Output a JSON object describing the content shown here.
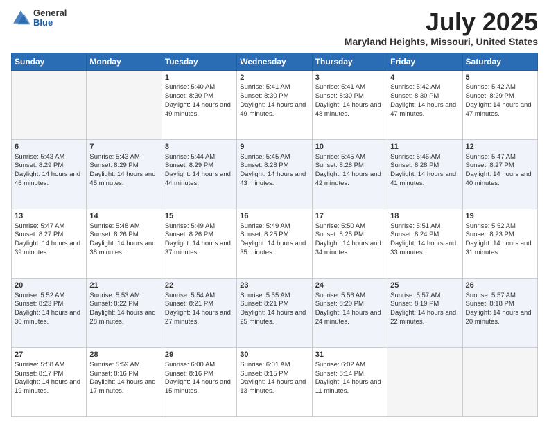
{
  "header": {
    "logo_general": "General",
    "logo_blue": "Blue",
    "month_title": "July 2025",
    "location": "Maryland Heights, Missouri, United States"
  },
  "days_of_week": [
    "Sunday",
    "Monday",
    "Tuesday",
    "Wednesday",
    "Thursday",
    "Friday",
    "Saturday"
  ],
  "weeks": [
    [
      {
        "day": "",
        "sunrise": "",
        "sunset": "",
        "daylight": "",
        "empty": true
      },
      {
        "day": "",
        "sunrise": "",
        "sunset": "",
        "daylight": "",
        "empty": true
      },
      {
        "day": "1",
        "sunrise": "Sunrise: 5:40 AM",
        "sunset": "Sunset: 8:30 PM",
        "daylight": "Daylight: 14 hours and 49 minutes.",
        "empty": false
      },
      {
        "day": "2",
        "sunrise": "Sunrise: 5:41 AM",
        "sunset": "Sunset: 8:30 PM",
        "daylight": "Daylight: 14 hours and 49 minutes.",
        "empty": false
      },
      {
        "day": "3",
        "sunrise": "Sunrise: 5:41 AM",
        "sunset": "Sunset: 8:30 PM",
        "daylight": "Daylight: 14 hours and 48 minutes.",
        "empty": false
      },
      {
        "day": "4",
        "sunrise": "Sunrise: 5:42 AM",
        "sunset": "Sunset: 8:30 PM",
        "daylight": "Daylight: 14 hours and 47 minutes.",
        "empty": false
      },
      {
        "day": "5",
        "sunrise": "Sunrise: 5:42 AM",
        "sunset": "Sunset: 8:29 PM",
        "daylight": "Daylight: 14 hours and 47 minutes.",
        "empty": false
      }
    ],
    [
      {
        "day": "6",
        "sunrise": "Sunrise: 5:43 AM",
        "sunset": "Sunset: 8:29 PM",
        "daylight": "Daylight: 14 hours and 46 minutes.",
        "empty": false
      },
      {
        "day": "7",
        "sunrise": "Sunrise: 5:43 AM",
        "sunset": "Sunset: 8:29 PM",
        "daylight": "Daylight: 14 hours and 45 minutes.",
        "empty": false
      },
      {
        "day": "8",
        "sunrise": "Sunrise: 5:44 AM",
        "sunset": "Sunset: 8:29 PM",
        "daylight": "Daylight: 14 hours and 44 minutes.",
        "empty": false
      },
      {
        "day": "9",
        "sunrise": "Sunrise: 5:45 AM",
        "sunset": "Sunset: 8:28 PM",
        "daylight": "Daylight: 14 hours and 43 minutes.",
        "empty": false
      },
      {
        "day": "10",
        "sunrise": "Sunrise: 5:45 AM",
        "sunset": "Sunset: 8:28 PM",
        "daylight": "Daylight: 14 hours and 42 minutes.",
        "empty": false
      },
      {
        "day": "11",
        "sunrise": "Sunrise: 5:46 AM",
        "sunset": "Sunset: 8:28 PM",
        "daylight": "Daylight: 14 hours and 41 minutes.",
        "empty": false
      },
      {
        "day": "12",
        "sunrise": "Sunrise: 5:47 AM",
        "sunset": "Sunset: 8:27 PM",
        "daylight": "Daylight: 14 hours and 40 minutes.",
        "empty": false
      }
    ],
    [
      {
        "day": "13",
        "sunrise": "Sunrise: 5:47 AM",
        "sunset": "Sunset: 8:27 PM",
        "daylight": "Daylight: 14 hours and 39 minutes.",
        "empty": false
      },
      {
        "day": "14",
        "sunrise": "Sunrise: 5:48 AM",
        "sunset": "Sunset: 8:26 PM",
        "daylight": "Daylight: 14 hours and 38 minutes.",
        "empty": false
      },
      {
        "day": "15",
        "sunrise": "Sunrise: 5:49 AM",
        "sunset": "Sunset: 8:26 PM",
        "daylight": "Daylight: 14 hours and 37 minutes.",
        "empty": false
      },
      {
        "day": "16",
        "sunrise": "Sunrise: 5:49 AM",
        "sunset": "Sunset: 8:25 PM",
        "daylight": "Daylight: 14 hours and 35 minutes.",
        "empty": false
      },
      {
        "day": "17",
        "sunrise": "Sunrise: 5:50 AM",
        "sunset": "Sunset: 8:25 PM",
        "daylight": "Daylight: 14 hours and 34 minutes.",
        "empty": false
      },
      {
        "day": "18",
        "sunrise": "Sunrise: 5:51 AM",
        "sunset": "Sunset: 8:24 PM",
        "daylight": "Daylight: 14 hours and 33 minutes.",
        "empty": false
      },
      {
        "day": "19",
        "sunrise": "Sunrise: 5:52 AM",
        "sunset": "Sunset: 8:23 PM",
        "daylight": "Daylight: 14 hours and 31 minutes.",
        "empty": false
      }
    ],
    [
      {
        "day": "20",
        "sunrise": "Sunrise: 5:52 AM",
        "sunset": "Sunset: 8:23 PM",
        "daylight": "Daylight: 14 hours and 30 minutes.",
        "empty": false
      },
      {
        "day": "21",
        "sunrise": "Sunrise: 5:53 AM",
        "sunset": "Sunset: 8:22 PM",
        "daylight": "Daylight: 14 hours and 28 minutes.",
        "empty": false
      },
      {
        "day": "22",
        "sunrise": "Sunrise: 5:54 AM",
        "sunset": "Sunset: 8:21 PM",
        "daylight": "Daylight: 14 hours and 27 minutes.",
        "empty": false
      },
      {
        "day": "23",
        "sunrise": "Sunrise: 5:55 AM",
        "sunset": "Sunset: 8:21 PM",
        "daylight": "Daylight: 14 hours and 25 minutes.",
        "empty": false
      },
      {
        "day": "24",
        "sunrise": "Sunrise: 5:56 AM",
        "sunset": "Sunset: 8:20 PM",
        "daylight": "Daylight: 14 hours and 24 minutes.",
        "empty": false
      },
      {
        "day": "25",
        "sunrise": "Sunrise: 5:57 AM",
        "sunset": "Sunset: 8:19 PM",
        "daylight": "Daylight: 14 hours and 22 minutes.",
        "empty": false
      },
      {
        "day": "26",
        "sunrise": "Sunrise: 5:57 AM",
        "sunset": "Sunset: 8:18 PM",
        "daylight": "Daylight: 14 hours and 20 minutes.",
        "empty": false
      }
    ],
    [
      {
        "day": "27",
        "sunrise": "Sunrise: 5:58 AM",
        "sunset": "Sunset: 8:17 PM",
        "daylight": "Daylight: 14 hours and 19 minutes.",
        "empty": false
      },
      {
        "day": "28",
        "sunrise": "Sunrise: 5:59 AM",
        "sunset": "Sunset: 8:16 PM",
        "daylight": "Daylight: 14 hours and 17 minutes.",
        "empty": false
      },
      {
        "day": "29",
        "sunrise": "Sunrise: 6:00 AM",
        "sunset": "Sunset: 8:16 PM",
        "daylight": "Daylight: 14 hours and 15 minutes.",
        "empty": false
      },
      {
        "day": "30",
        "sunrise": "Sunrise: 6:01 AM",
        "sunset": "Sunset: 8:15 PM",
        "daylight": "Daylight: 14 hours and 13 minutes.",
        "empty": false
      },
      {
        "day": "31",
        "sunrise": "Sunrise: 6:02 AM",
        "sunset": "Sunset: 8:14 PM",
        "daylight": "Daylight: 14 hours and 11 minutes.",
        "empty": false
      },
      {
        "day": "",
        "sunrise": "",
        "sunset": "",
        "daylight": "",
        "empty": true
      },
      {
        "day": "",
        "sunrise": "",
        "sunset": "",
        "daylight": "",
        "empty": true
      }
    ]
  ]
}
